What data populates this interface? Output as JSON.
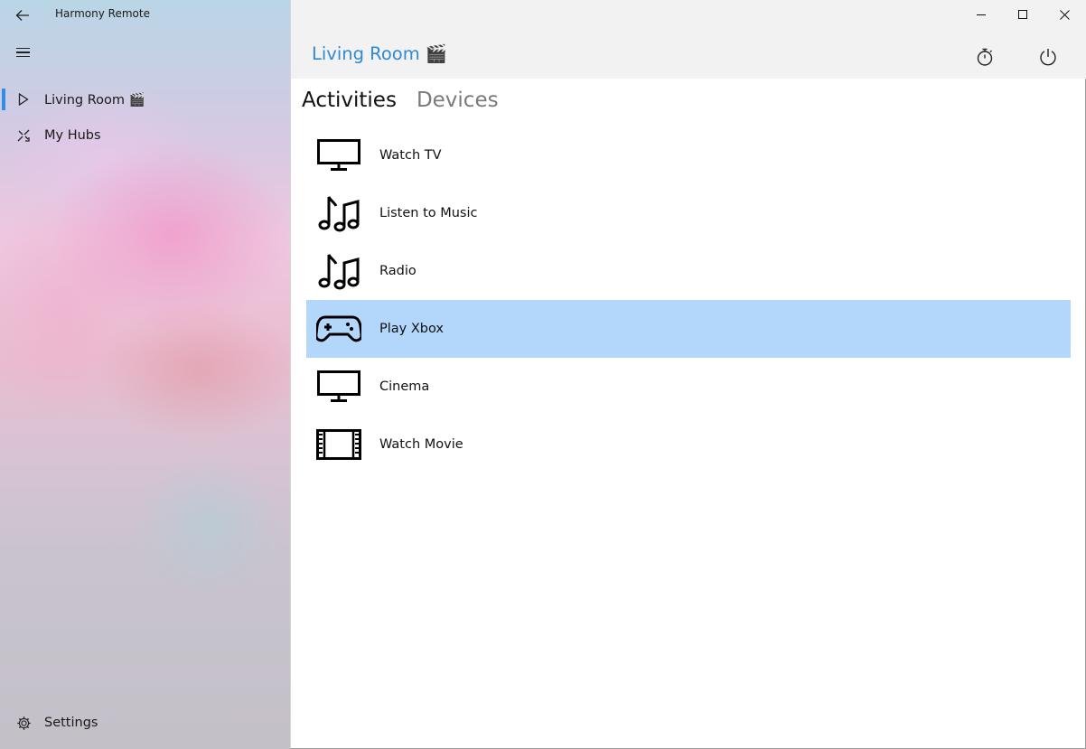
{
  "app": {
    "title": "Harmony Remote"
  },
  "sidebar": {
    "items": [
      {
        "label": "Living Room 🎬",
        "icon": "play-outline-icon",
        "selected": true
      },
      {
        "label": "My Hubs",
        "icon": "hubs-icon",
        "selected": false
      }
    ],
    "settings_label": "Settings"
  },
  "header": {
    "title": "Living Room 🎬"
  },
  "tabs": [
    {
      "label": "Activities",
      "active": true
    },
    {
      "label": "Devices",
      "active": false
    }
  ],
  "activities": [
    {
      "label": "Watch TV",
      "icon": "tv-icon",
      "selected": false
    },
    {
      "label": "Listen to Music",
      "icon": "music-notes-icon",
      "selected": false
    },
    {
      "label": "Radio",
      "icon": "music-notes-icon",
      "selected": false
    },
    {
      "label": "Play Xbox",
      "icon": "gamepad-icon",
      "selected": true
    },
    {
      "label": "Cinema",
      "icon": "tv-icon",
      "selected": false
    },
    {
      "label": "Watch Movie",
      "icon": "film-strip-icon",
      "selected": false
    }
  ],
  "colors": {
    "accent": "#2f8ad4",
    "selection": "#b3d7fb",
    "nav_indicator": "#2f8fe4"
  }
}
